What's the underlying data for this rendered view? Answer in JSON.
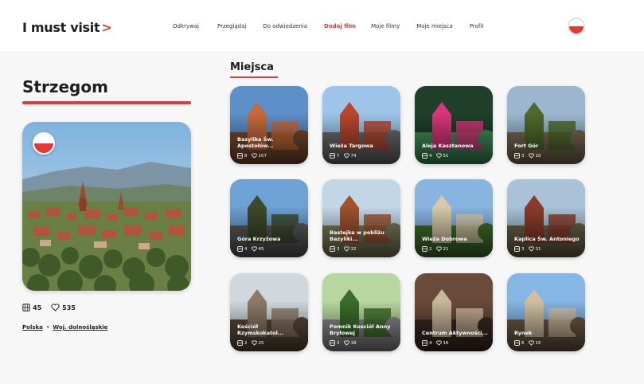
{
  "header": {
    "logo_text": "I must visit",
    "logo_arrow": ">",
    "nav": [
      "Odkrywaj",
      "Przeglądaj",
      "Do odwiedzenia",
      "Dodaj film",
      "Moje filmy",
      "Moje miejsca",
      "Profil"
    ],
    "active_nav": "Dodaj film"
  },
  "city": {
    "name": "Strzegom",
    "videos": "45",
    "likes": "535",
    "breadcrumb": [
      "Polska",
      "Woj. dolnośląskie"
    ],
    "breadcrumb_sep": "•"
  },
  "places": {
    "title": "Miejsca",
    "items": [
      {
        "title": "Bazylika Św. Apostołów...",
        "videos": "8",
        "likes": "107"
      },
      {
        "title": "Wieża Targowa",
        "videos": "7",
        "likes": "74"
      },
      {
        "title": "Aleja Kasztanowa",
        "videos": "4",
        "likes": "51"
      },
      {
        "title": "Fort Gór",
        "videos": "3",
        "likes": "10"
      },
      {
        "title": "Góra Krzyżowa",
        "videos": "4",
        "likes": "45"
      },
      {
        "title": "Bastejka w pobliżu Bazyliki...",
        "videos": "3",
        "likes": "32"
      },
      {
        "title": "Wieża Dobrowa",
        "videos": "2",
        "likes": "21"
      },
      {
        "title": "Kaplica Św. Antoniego",
        "videos": "3",
        "likes": "31"
      },
      {
        "title": "Kościół Rzymskokatol...",
        "videos": "2",
        "likes": "25"
      },
      {
        "title": "Pomnik Kosciół Anny Bryłowej",
        "videos": "3",
        "likes": "18"
      },
      {
        "title": "Centrum Aktywności...",
        "videos": "4",
        "likes": "16"
      },
      {
        "title": "Rynek",
        "videos": "6",
        "likes": "15"
      }
    ]
  },
  "colors": {
    "accent": "#e53935",
    "text": "#1d1d1d",
    "background": "#f7f7f7"
  }
}
